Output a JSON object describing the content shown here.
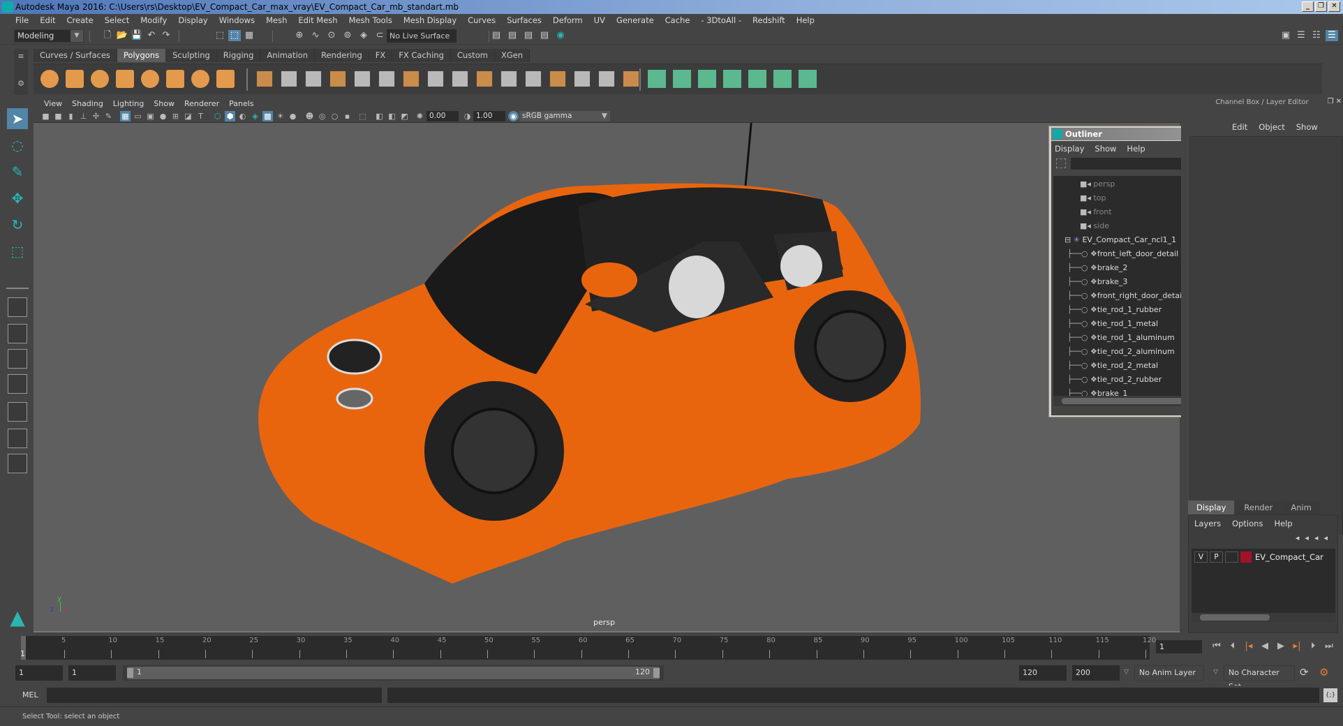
{
  "window": {
    "title": "Autodesk Maya 2016: C:\\Users\\rs\\Desktop\\EV_Compact_Car_max_vray\\EV_Compact_Car_mb_standart.mb",
    "minimize": "_",
    "restore": "❐",
    "close": "✕"
  },
  "menubar": [
    "File",
    "Edit",
    "Create",
    "Select",
    "Modify",
    "Display",
    "Windows",
    "Mesh",
    "Edit Mesh",
    "Mesh Tools",
    "Mesh Display",
    "Curves",
    "Surfaces",
    "Deform",
    "UV",
    "Generate",
    "Cache",
    "- 3DtoAll -",
    "Redshift",
    "Help"
  ],
  "statusline": {
    "mode": "Modeling",
    "live_surface": "No Live Surface"
  },
  "shelf": {
    "tabs": [
      "Curves / Surfaces",
      "Polygons",
      "Sculpting",
      "Rigging",
      "Animation",
      "Rendering",
      "FX",
      "FX Caching",
      "Custom",
      "XGen"
    ],
    "active_tab": "Polygons",
    "poly_icon_color": "#e39a4c",
    "green_icon_color": "#5cb88e"
  },
  "panel": {
    "menu": [
      "View",
      "Shading",
      "Lighting",
      "Show",
      "Renderer",
      "Panels"
    ],
    "exposure": "0.00",
    "gamma": "1.00",
    "color_space": "sRGB gamma",
    "camera_label": "persp"
  },
  "outliner": {
    "title": "Outliner",
    "menu": [
      "Display",
      "Show",
      "Help"
    ],
    "items": [
      {
        "label": "persp",
        "type": "camera"
      },
      {
        "label": "top",
        "type": "camera"
      },
      {
        "label": "front",
        "type": "camera"
      },
      {
        "label": "side",
        "type": "camera"
      },
      {
        "label": "EV_Compact_Car_ncl1_1",
        "type": "group"
      },
      {
        "label": "front_left_door_detail",
        "type": "mesh"
      },
      {
        "label": "brake_2",
        "type": "mesh"
      },
      {
        "label": "brake_3",
        "type": "mesh"
      },
      {
        "label": "front_right_door_detail",
        "type": "mesh"
      },
      {
        "label": "tie_rod_1_rubber",
        "type": "mesh"
      },
      {
        "label": "tie_rod_1_metal",
        "type": "mesh"
      },
      {
        "label": "tie_rod_1_aluminum",
        "type": "mesh"
      },
      {
        "label": "tie_rod_2_aluminum",
        "type": "mesh"
      },
      {
        "label": "tie_rod_2_metal",
        "type": "mesh"
      },
      {
        "label": "tie_rod_2_rubber",
        "type": "mesh"
      },
      {
        "label": "brake_1",
        "type": "mesh"
      }
    ]
  },
  "channelbox": {
    "title": "Channel Box / Layer Editor",
    "menu": [
      "Edit",
      "Object",
      "Show"
    ]
  },
  "layers": {
    "tabs": [
      "Display",
      "Render",
      "Anim"
    ],
    "active_tab": "Display",
    "menu": [
      "Layers",
      "Options",
      "Help"
    ],
    "rows": [
      {
        "v": "V",
        "p": "P",
        "name": "EV_Compact_Car",
        "color": "#a3112b"
      }
    ]
  },
  "timeline": {
    "ticks": [
      5,
      10,
      15,
      20,
      25,
      30,
      35,
      40,
      45,
      50,
      55,
      60,
      65,
      70,
      75,
      80,
      85,
      90,
      95,
      100,
      105,
      110,
      115,
      120
    ],
    "start": 1,
    "end": 120,
    "current_frame_marker": "1",
    "current_frame": "1"
  },
  "range": {
    "start_time": "1",
    "playback_start": "1",
    "slider_start": "1",
    "slider_end": "120",
    "playback_end": "120",
    "end_time": "200",
    "anim_layer": "No Anim Layer",
    "character_set": "No Character Set"
  },
  "cmdline": {
    "label": "MEL"
  },
  "helpline": {
    "text": "Select Tool: select an object"
  }
}
